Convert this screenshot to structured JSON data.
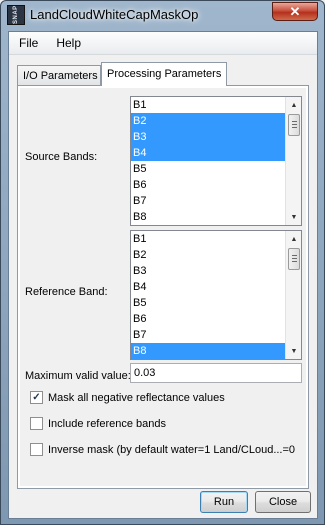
{
  "window": {
    "title": "LandCloudWhiteCapMaskOp",
    "icon_text": "SNAP",
    "close_glyph": "✕"
  },
  "menu": [
    "File",
    "Help"
  ],
  "tabs": [
    {
      "label": "I/O Parameters",
      "active": false
    },
    {
      "label": "Processing Parameters",
      "active": true
    }
  ],
  "source_bands": {
    "label": "Source Bands:",
    "items": [
      {
        "name": "B1",
        "selected": false
      },
      {
        "name": "B2",
        "selected": true
      },
      {
        "name": "B3",
        "selected": true
      },
      {
        "name": "B4",
        "selected": true
      },
      {
        "name": "B5",
        "selected": false
      },
      {
        "name": "B6",
        "selected": false
      },
      {
        "name": "B7",
        "selected": false
      },
      {
        "name": "B8",
        "selected": false
      }
    ]
  },
  "reference_band": {
    "label": "Reference Band:",
    "items": [
      {
        "name": "B1",
        "selected": false
      },
      {
        "name": "B2",
        "selected": false
      },
      {
        "name": "B3",
        "selected": false
      },
      {
        "name": "B4",
        "selected": false
      },
      {
        "name": "B5",
        "selected": false
      },
      {
        "name": "B6",
        "selected": false
      },
      {
        "name": "B7",
        "selected": false
      },
      {
        "name": "B8",
        "selected": true
      }
    ]
  },
  "max_valid": {
    "label": "Maximum valid value:",
    "value": "0.03"
  },
  "checkboxes": [
    {
      "label": "Mask all negative reflectance values",
      "checked": true
    },
    {
      "label": "Include reference bands",
      "checked": false
    },
    {
      "label": "Inverse mask (by default water=1 Land/CLoud...=0",
      "checked": false
    }
  ],
  "buttons": {
    "run": "Run",
    "close": "Close"
  },
  "colors": {
    "selection": "#3399ff",
    "titlebar": "#8aa3bb",
    "close_button": "#c44a36"
  }
}
